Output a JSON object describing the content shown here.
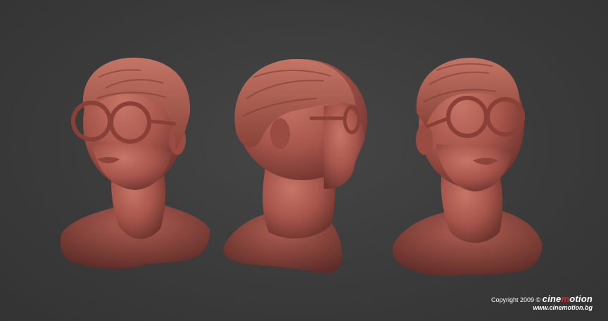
{
  "image": {
    "background_color": "#3a3a3a",
    "clay_color": "#a8564c",
    "subject": "three sculpted clay busts of a person wearing round glasses"
  },
  "credit": {
    "copyright": "Copyright 2009 ©",
    "brand_part1": "cine",
    "brand_part2": "m",
    "brand_part3": "otion",
    "url": "www.cinemotion.bg",
    "brand_accent_color": "#d42a2a"
  }
}
